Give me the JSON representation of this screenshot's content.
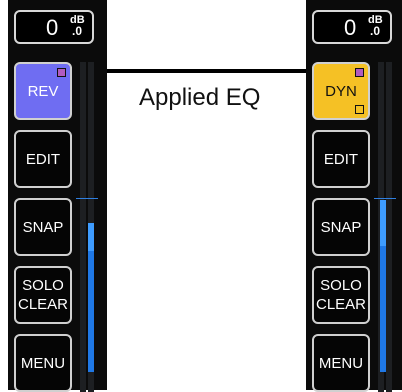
{
  "left_strip": {
    "gain": {
      "value": "0",
      "unit": "dB",
      "fraction": ".0"
    },
    "buttons": {
      "rev": "REV",
      "edit": "EDIT",
      "snap": "SNAP",
      "solo_clear": "SOLO\nCLEAR",
      "menu": "MENU"
    },
    "meter_level_pct": 45
  },
  "right_strip": {
    "gain": {
      "value": "0",
      "unit": "dB",
      "fraction": ".0"
    },
    "buttons": {
      "dyn": "DYN",
      "edit": "EDIT",
      "snap": "SNAP",
      "solo_clear": "SOLO\nCLEAR",
      "menu": "MENU"
    },
    "meter_level_pct": 52
  },
  "annotation": {
    "label": "Applied EQ"
  },
  "colors": {
    "rev": "#6f6df2",
    "dyn": "#f5c125",
    "meter": "#1f78e6",
    "indicator": "#b15bbf"
  }
}
